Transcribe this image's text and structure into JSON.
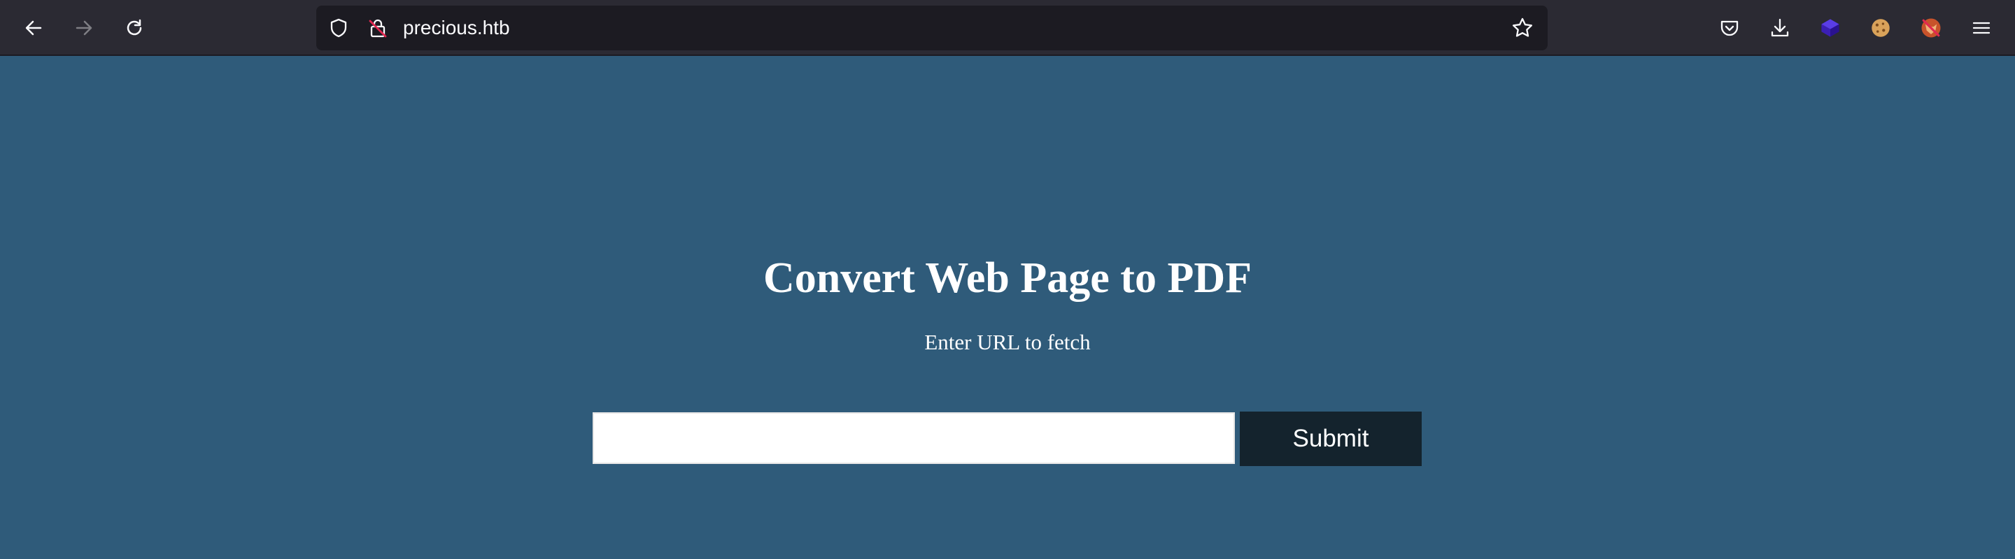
{
  "browser": {
    "url": "precious.htb",
    "icons": {
      "back": "back-arrow-icon",
      "forward": "forward-arrow-icon",
      "reload": "reload-icon",
      "tracking": "shield-icon",
      "insecure": "insecure-lock-icon",
      "bookmark": "star-icon",
      "pocket": "pocket-icon",
      "downloads": "download-icon",
      "menu": "hamburger-menu-icon"
    },
    "extensions": [
      "purple-cube-extension-icon",
      "cookie-extension-icon",
      "fox-extension-icon"
    ]
  },
  "page": {
    "title": "Convert Web Page to PDF",
    "subtitle": "Enter URL to fetch",
    "url_input_value": "",
    "submit_label": "Submit"
  },
  "colors": {
    "page_background": "#2f5b7a",
    "toolbar_background": "#2b2a33",
    "submit_background": "#14232d"
  }
}
